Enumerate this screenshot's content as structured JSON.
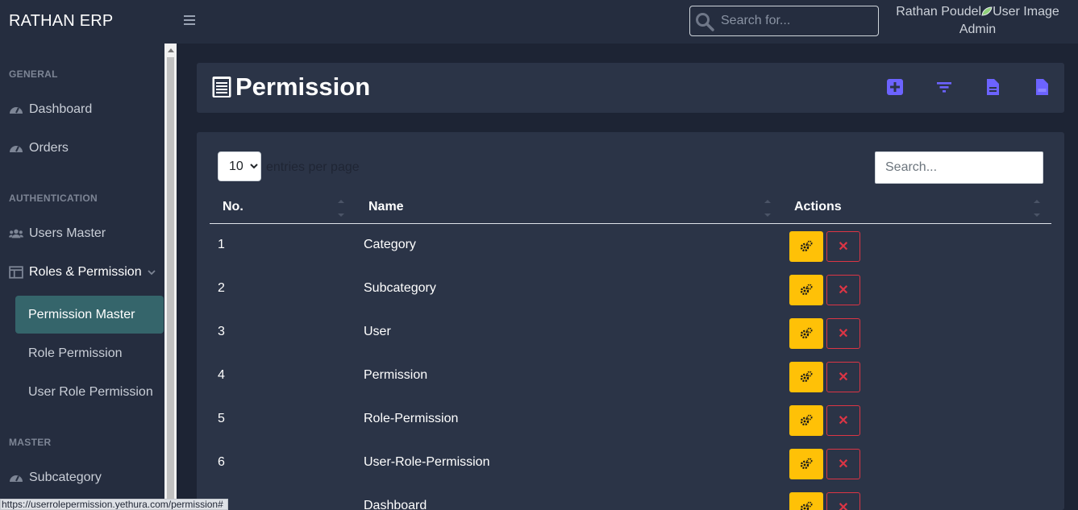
{
  "app": {
    "brand": "RATHAN ERP"
  },
  "topbar": {
    "search_placeholder": "Search for...",
    "user_name": "Rathan Poudel",
    "user_image_alt": "User Image",
    "user_role": "Admin"
  },
  "sidebar": {
    "sections": {
      "general": "GENERAL",
      "authentication": "AUTHENTICATION",
      "master": "MASTER"
    },
    "items": {
      "dashboard": "Dashboard",
      "orders": "Orders",
      "users_master": "Users Master",
      "roles_permission": "Roles & Permission",
      "permission_master": "Permission Master",
      "role_permission": "Role Permission",
      "user_role_permission": "User Role Permission",
      "subcategory": "Subcategory"
    },
    "active_item": "Permission Master"
  },
  "page": {
    "title": "Permission",
    "toolbar_icons": [
      "add-icon",
      "filter-icon",
      "document-icon",
      "pdf-icon"
    ],
    "accent_color": "#6c63ff"
  },
  "table": {
    "page_size": "10",
    "page_size_options": [
      "10"
    ],
    "per_page_label": "entries per page",
    "search_placeholder": "Search...",
    "headers": {
      "no": "No.",
      "name": "Name",
      "actions": "Actions"
    },
    "rows": [
      {
        "no": "1",
        "name": "Category"
      },
      {
        "no": "2",
        "name": "Subcategory"
      },
      {
        "no": "3",
        "name": "User"
      },
      {
        "no": "4",
        "name": "Permission"
      },
      {
        "no": "5",
        "name": "Role-Permission"
      },
      {
        "no": "6",
        "name": "User-Role-Permission"
      },
      {
        "no": "",
        "name": "Dashboard"
      }
    ],
    "edit_button_color": "#ffc107",
    "delete_button_color": "#dc3545"
  },
  "status_url": "https://userrolepermission.yethura.com/permission#"
}
